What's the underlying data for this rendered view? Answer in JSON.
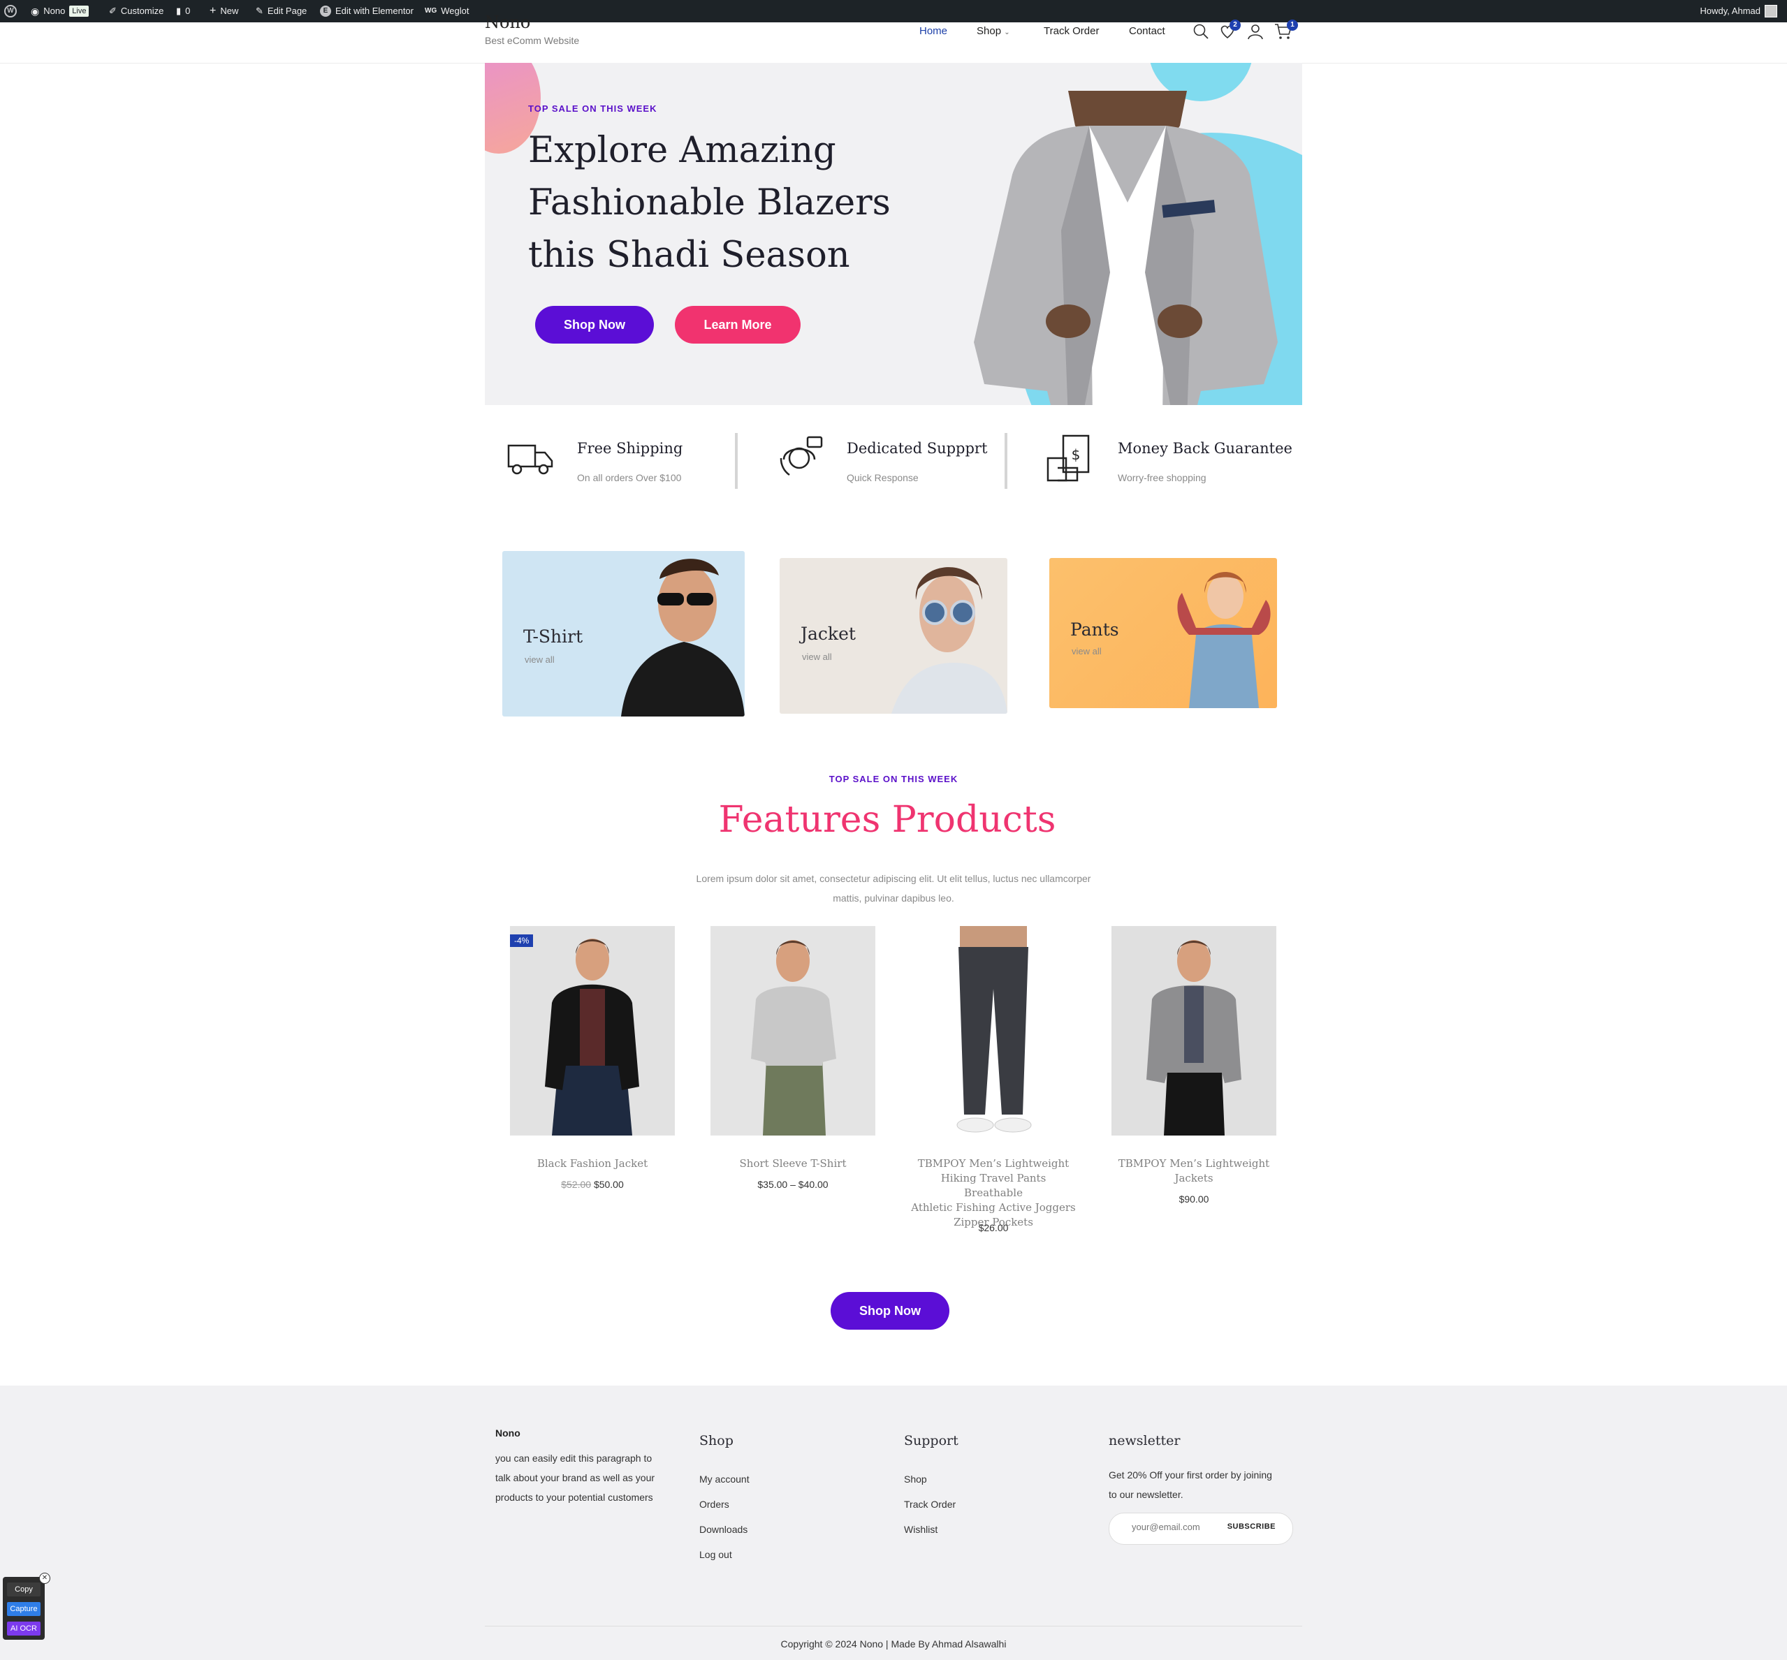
{
  "adminbar": {
    "site": "Nono",
    "live": "Live",
    "customize": "Customize",
    "comments": "0",
    "new": "New",
    "edit_page": "Edit Page",
    "edit_elementor": "Edit with Elementor",
    "weglot": "Weglot",
    "howdy": "Howdy, Ahmad"
  },
  "header": {
    "site_title": "Nono",
    "tagline": "Best eComm Website",
    "nav": [
      "Home",
      "Shop",
      "Track Order",
      "Contact"
    ],
    "wishlist_count": "2",
    "cart_count": "1"
  },
  "hero": {
    "kicker": "TOP SALE ON THIS WEEK",
    "title_line1": "Explore Amazing",
    "title_line2": "Fashionable Blazers",
    "title_line3": "this Shadi Season",
    "btn_primary": "Shop Now",
    "btn_secondary": "Learn More"
  },
  "features": [
    {
      "title": "Free Shipping",
      "sub": "On all orders Over $100",
      "icon": "truck-icon"
    },
    {
      "title": "Dedicated Suppprt",
      "sub": "Quick Response",
      "icon": "support-icon"
    },
    {
      "title": "Money Back Guarantee",
      "sub": "Worry-free shopping",
      "icon": "money-icon"
    }
  ],
  "categories": [
    {
      "title": "T-Shirt",
      "sub": "view all"
    },
    {
      "title": "Jacket",
      "sub": "view all"
    },
    {
      "title": "Pants",
      "sub": "view all"
    }
  ],
  "products_section": {
    "kicker": "TOP SALE ON THIS WEEK",
    "title": "Features Products",
    "desc_line1": "Lorem ipsum dolor sit amet, consectetur adipiscing elit. Ut elit tellus, luctus nec ullamcorper",
    "desc_line2": "mattis, pulvinar dapibus leo.",
    "cta": "Shop Now"
  },
  "products": [
    {
      "name_lines": [
        "Black Fashion Jacket"
      ],
      "old_price": "$52.00",
      "price": "$50.00",
      "badge": "-4%"
    },
    {
      "name_lines": [
        "Short Sleeve T-Shirt"
      ],
      "price": "$35.00 – $40.00"
    },
    {
      "name_lines": [
        "TBMPOY Men’s Lightweight",
        "Hiking Travel Pants Breathable",
        "Athletic Fishing Active Joggers",
        "Zipper Pockets"
      ],
      "price": "$26.00"
    },
    {
      "name_lines": [
        "TBMPOY Men’s Lightweight",
        "Jackets"
      ],
      "price": "$90.00"
    }
  ],
  "footer": {
    "brand": "Nono",
    "about_line1": "you can easily edit this paragraph to",
    "about_line2": "talk about your brand as well as your",
    "about_line3": "products to your potential customers",
    "shop_head": "Shop",
    "shop_links": [
      "My account",
      "Orders",
      "Downloads",
      "Log out"
    ],
    "support_head": "Support",
    "support_links": [
      "Shop",
      "Track Order",
      "Wishlist"
    ],
    "newsletter_head": "newsletter",
    "newsletter_line1": "Get 20% Off your first order by joining",
    "newsletter_line2": "to our newsletter.",
    "email_placeholder": "your@email.com",
    "subscribe": "SUBSCRIBE",
    "copyright": "Copyright © 2024 Nono | Made By Ahmad Alsawalhi"
  },
  "widget": {
    "copy": "Copy",
    "capture": "Capture",
    "ocr": "AI OCR"
  },
  "colors": {
    "accent_purple": "#5b0ed6",
    "accent_pink": "#f1336f",
    "nav_active": "#1b3fa8",
    "hero_cyan": "#7fd9ef"
  }
}
